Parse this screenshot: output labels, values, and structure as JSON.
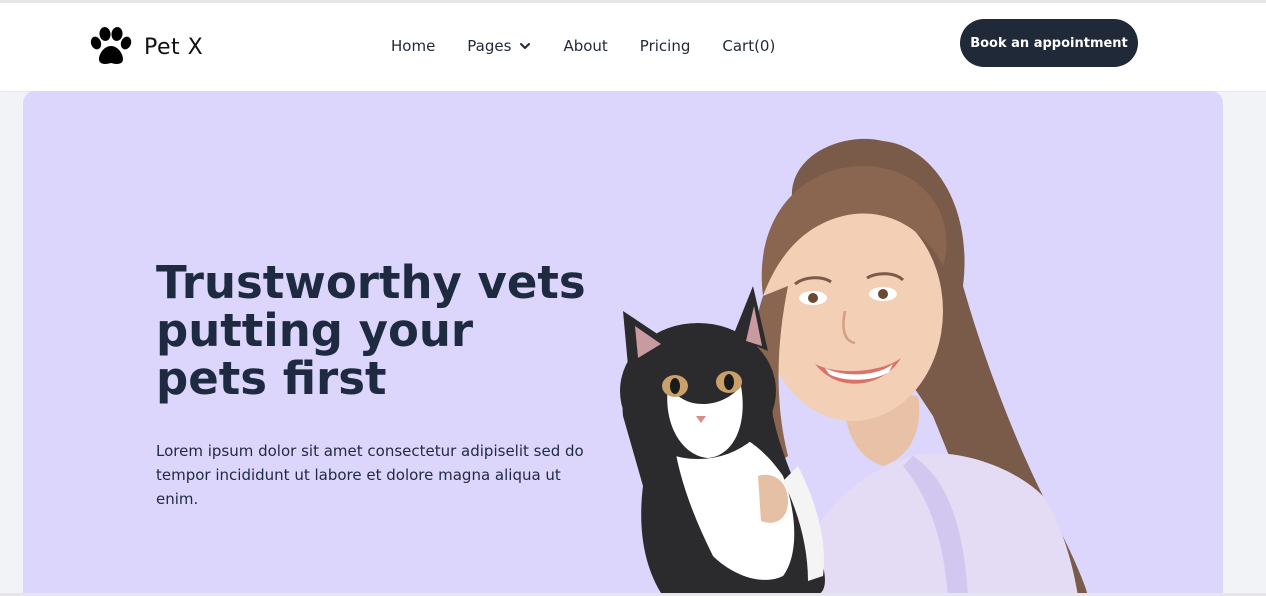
{
  "brand": {
    "name": "Pet X",
    "logo_icon": "paw-icon"
  },
  "nav": {
    "items": [
      {
        "label": "Home"
      },
      {
        "label": "Pages",
        "icon": "chevron-down-icon"
      },
      {
        "label": "About"
      },
      {
        "label": "Pricing"
      },
      {
        "label": "Cart(0)"
      }
    ]
  },
  "cta": {
    "label": "Book an appointment"
  },
  "hero": {
    "title": "Trustworthy vets putting your pets first",
    "description": "Lorem ipsum dolor sit amet consectetur adipiselit sed do tempor incididunt ut labore et dolore magna aliqua ut enim.",
    "image_subject": "woman-holding-cat"
  },
  "colors": {
    "hero_background": "#dcd6fd",
    "button_background": "#1f2937",
    "text_dark": "#1e2a3f"
  }
}
